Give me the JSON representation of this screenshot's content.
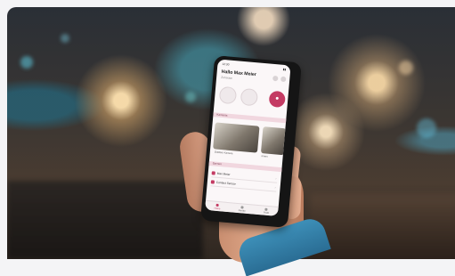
{
  "phone_screen": {
    "status_time": "12:30",
    "greeting": "Hallo Max Meier",
    "subtitle": "Zuhause",
    "sections": {
      "cameras": "Kameras",
      "scenes": "Szenen"
    },
    "cameras": [
      {
        "label": "Outdoor Kamera"
      },
      {
        "label": "Innen"
      }
    ],
    "list_rows": [
      {
        "label": "Max Meier"
      },
      {
        "label": "Contact Sensor"
      }
    ],
    "tabs": [
      {
        "label": "Home"
      },
      {
        "label": "Geräte"
      },
      {
        "label": "Profil"
      }
    ],
    "accent_color": "#c43b63"
  }
}
